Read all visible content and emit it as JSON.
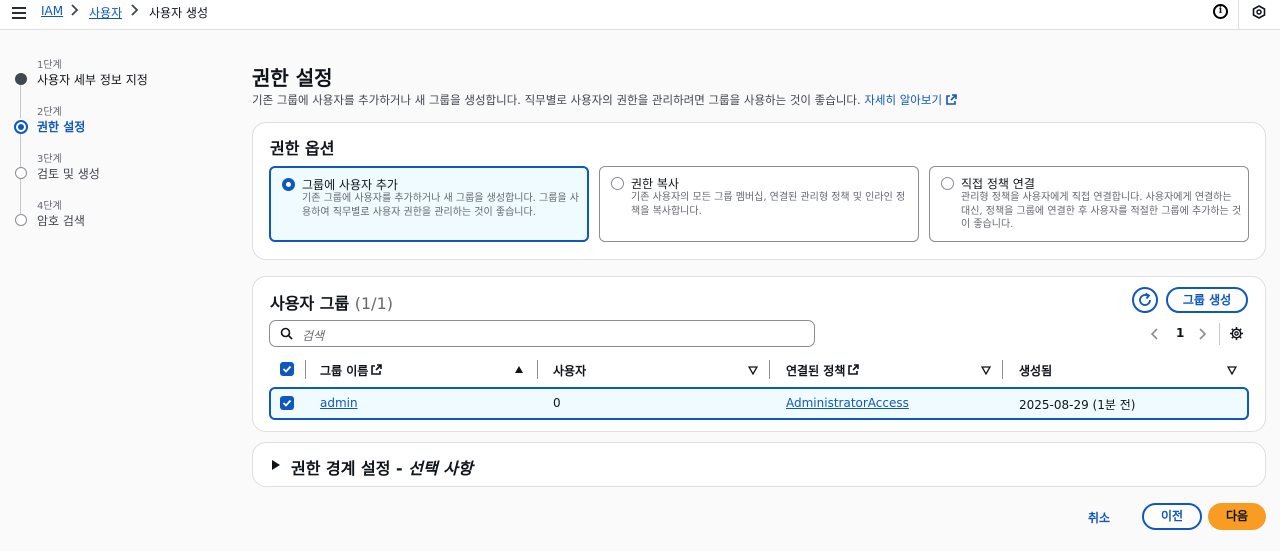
{
  "breadcrumb": {
    "items": [
      "IAM",
      "사용자",
      "사용자 생성"
    ]
  },
  "steps": [
    {
      "label": "1단계",
      "title": "사용자 세부 정보 지정",
      "state": "completed"
    },
    {
      "label": "2단계",
      "title": "권한 설정",
      "state": "current"
    },
    {
      "label": "3단계",
      "title": "검토 및 생성",
      "state": "pending"
    },
    {
      "label": "4단계",
      "title": "암호 검색",
      "state": "pending"
    }
  ],
  "header": {
    "title": "권한 설정",
    "description": "기존 그룹에 사용자를 추가하거나 새 그룹을 생성합니다. 직무별로 사용자의 권한을 관리하려면 그룹을 사용하는 것이 좋습니다.",
    "learn_more": "자세히 알아보기"
  },
  "permission_options": {
    "title": "권한 옵션",
    "options": [
      {
        "title": "그룹에 사용자 추가",
        "description": "기존 그룹에 사용자를 추가하거나 새 그룹을 생성합니다. 그룹을 사용하여 직무별로 사용자 권한을 관리하는 것이 좋습니다.",
        "selected": true
      },
      {
        "title": "권한 복사",
        "description": "기존 사용자의 모든 그룹 멤버십, 연결된 관리형 정책 및 인라인 정책을 복사합니다.",
        "selected": false
      },
      {
        "title": "직접 정책 연결",
        "description": "관리형 정책을 사용자에게 직접 연결합니다. 사용자에게 연결하는 대신, 정책을 그룹에 연결한 후 사용자를 적절한 그룹에 추가하는 것이 좋습니다.",
        "selected": false
      }
    ]
  },
  "user_groups": {
    "title": "사용자 그룹",
    "count": "(1/1)",
    "create_button": "그룹 생성",
    "search_placeholder": "검색",
    "page": "1",
    "columns": [
      "그룹 이름",
      "사용자",
      "연결된 정책",
      "생성됨"
    ],
    "rows": [
      {
        "name": "admin",
        "users": "0",
        "policy": "AdministratorAccess",
        "created": "2025-08-29 (1분 전)",
        "checked": true
      }
    ]
  },
  "boundary": {
    "title": "권한 경계 설정 - ",
    "title_optional": "선택 사항"
  },
  "footer": {
    "cancel": "취소",
    "previous": "이전",
    "next": "다음"
  },
  "colors": {
    "primary": "#0f58bd",
    "accent": "#f89c24"
  }
}
